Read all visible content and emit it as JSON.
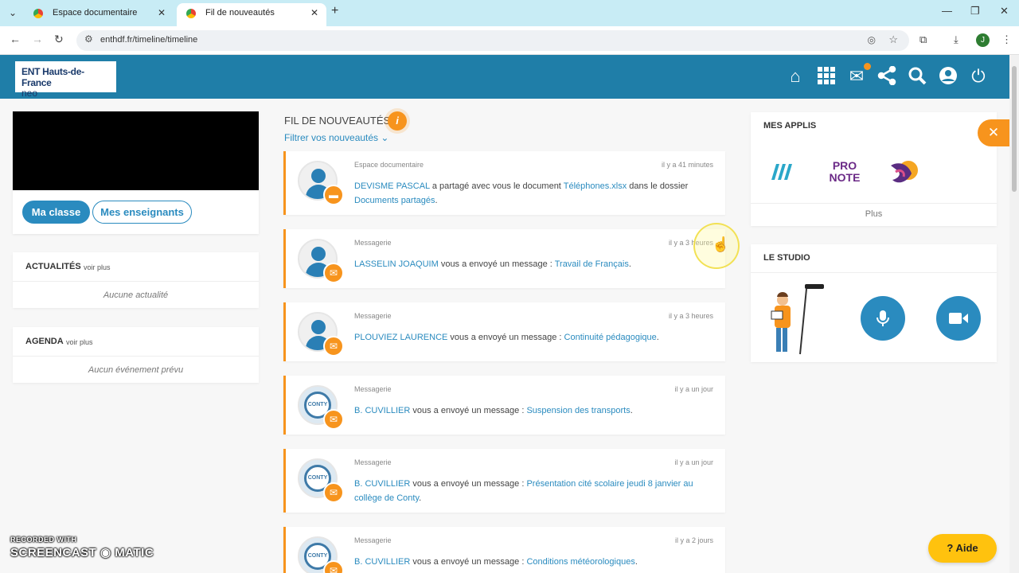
{
  "browser": {
    "tabs": [
      {
        "label": "Espace documentaire"
      },
      {
        "label": "Fil de nouveautés"
      }
    ],
    "url": "enthdf.fr/timeline/timeline",
    "profile_initial": "J"
  },
  "header": {
    "logo_line1": "ENT Hauts-de-France",
    "logo_line2": "neo",
    "mail_badge_color": "#f7941d"
  },
  "left": {
    "btn_class": "Ma classe",
    "btn_teachers": "Mes enseignants",
    "news": {
      "title": "ACTUALITÉS",
      "more": "voir plus",
      "empty": "Aucune actualité"
    },
    "agenda": {
      "title": "AGENDA",
      "more": "voir plus",
      "empty": "Aucun événement prévu"
    }
  },
  "feed": {
    "title": "FIL DE NOUVEAUTÉS",
    "info_glyph": "i",
    "filter": "Filtrer vos nouveautés",
    "items": [
      {
        "app": "Espace documentaire",
        "time": "il y a 41 minutes",
        "sender": "DEVISME PASCAL",
        "text1": " a partagé avec vous le document ",
        "link1": "Téléphones.xlsx",
        "text2": "  dans le dossier ",
        "link2": "Documents partagés",
        "text3": "."
      },
      {
        "app": "Messagerie",
        "time": "il y a 3 heures",
        "sender": "LASSELIN JOAQUIM",
        "text1": " vous a envoyé un message : ",
        "link1": "Travail de Français",
        "text2": "."
      },
      {
        "app": "Messagerie",
        "time": "il y a 3 heures",
        "sender": "PLOUVIEZ LAURENCE",
        "text1": " vous a envoyé un message : ",
        "link1": "Continuité pédagogique",
        "text2": "."
      },
      {
        "app": "Messagerie",
        "time": "il y a un jour",
        "sender": "B. CUVILLIER",
        "text1": " vous a envoyé un message : ",
        "link1": "Suspension des transports",
        "text2": "."
      },
      {
        "app": "Messagerie",
        "time": "il y a un jour",
        "sender": "B. CUVILLIER",
        "text1": " vous a envoyé un message : ",
        "link1": "Présentation cité scolaire jeudi 8 janvier au collège de Conty",
        "text2": "."
      },
      {
        "app": "Messagerie",
        "time": "il y a 2 jours",
        "sender": "B. CUVILLIER",
        "text1": " vous a envoyé un message : ",
        "link1": "Conditions météorologiques",
        "text2": "."
      }
    ]
  },
  "right": {
    "apps_title": "MES APPLIS",
    "apps": [
      "Maths app",
      "Pronote",
      "Parrot app"
    ],
    "pronote_l1": "PRO",
    "pronote_l2": "NOTE",
    "apps_more": "Plus",
    "studio_title": "LE STUDIO"
  },
  "overlay": {
    "watermark_l1": "RECORDED WITH",
    "watermark_l2": "SCREENCAST ◉ MATIC",
    "help": "Aide"
  }
}
